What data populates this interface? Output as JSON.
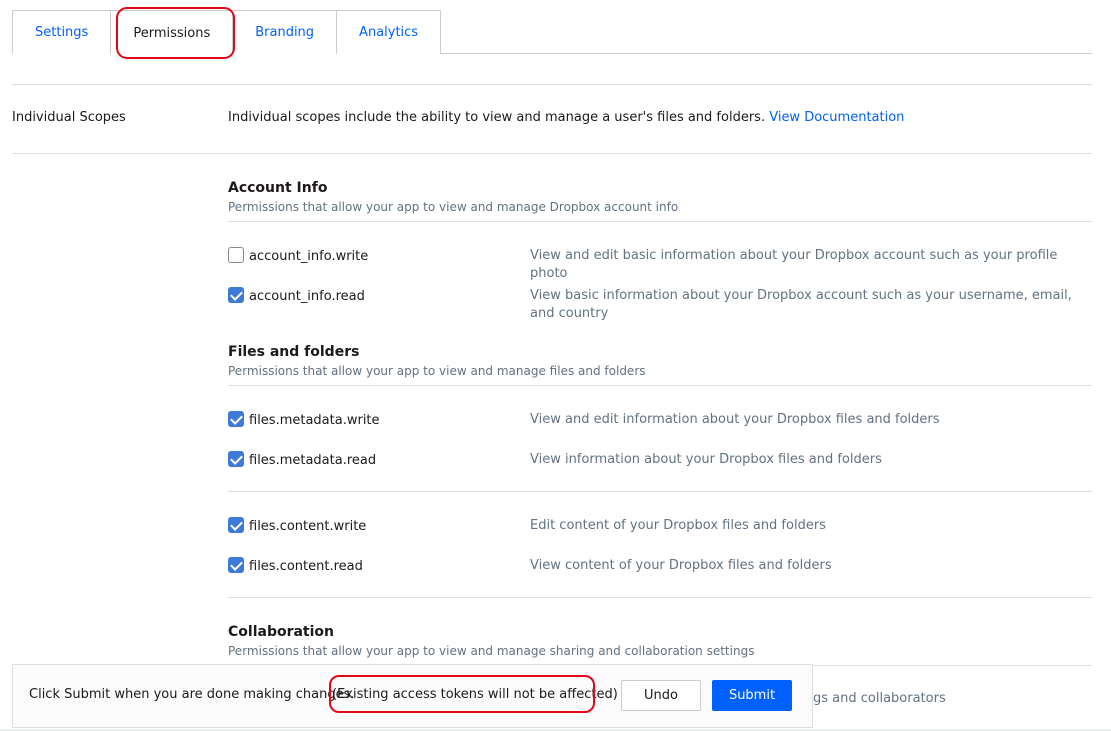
{
  "tabs": [
    {
      "label": "Settings",
      "active": false
    },
    {
      "label": "Permissions",
      "active": true
    },
    {
      "label": "Branding",
      "active": false
    },
    {
      "label": "Analytics",
      "active": false
    }
  ],
  "scopes": {
    "label": "Individual Scopes",
    "description": "Individual scopes include the ability to view and manage a user's files and folders.",
    "doc_link": "View Documentation"
  },
  "sections": {
    "account": {
      "title": "Account Info",
      "subtitle": "Permissions that allow your app to view and manage Dropbox account info",
      "perms": [
        {
          "name": "account_info.write",
          "checked": false,
          "desc": "View and edit basic information about your Dropbox account such as your profile photo"
        },
        {
          "name": "account_info.read",
          "checked": true,
          "desc": "View basic information about your Dropbox account such as your username, email, and country"
        }
      ]
    },
    "files": {
      "title": "Files and folders",
      "subtitle": "Permissions that allow your app to view and manage files and folders",
      "perms": [
        {
          "name": "files.metadata.write",
          "checked": true,
          "desc": "View and edit information about your Dropbox files and folders"
        },
        {
          "name": "files.metadata.read",
          "checked": true,
          "desc": "View information about your Dropbox files and folders"
        },
        {
          "name": "files.content.write",
          "checked": true,
          "desc": "Edit content of your Dropbox files and folders"
        },
        {
          "name": "files.content.read",
          "checked": true,
          "desc": "View content of your Dropbox files and folders"
        }
      ]
    },
    "collab": {
      "title": "Collaboration",
      "subtitle": "Permissions that allow your app to view and manage sharing and collaboration settings",
      "partial_desc": "gs and collaborators"
    }
  },
  "footer": {
    "message": "Click Submit when you are done making changes.",
    "note": "(Existing access tokens will not be affected)",
    "undo_label": "Undo",
    "submit_label": "Submit"
  },
  "colors": {
    "accent": "#0061fe",
    "checkbox": "#3d7bd7",
    "highlight": "#e0091a"
  }
}
